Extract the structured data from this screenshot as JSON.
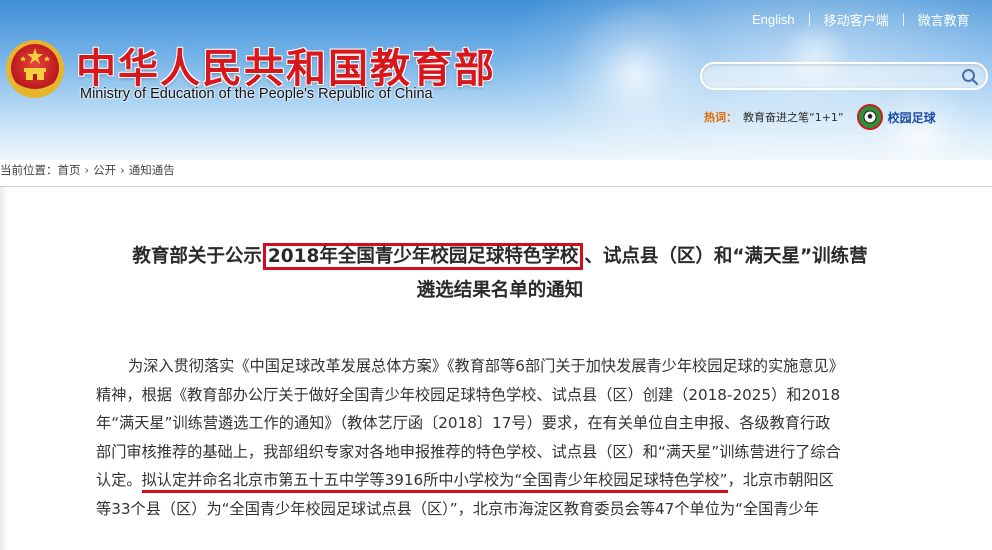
{
  "header": {
    "site_title": "中华人民共和国教育部",
    "site_subtitle": "Ministry of Education of the People's Republic of China",
    "top_links": [
      "English",
      "移动客户端",
      "微言教育"
    ],
    "search": {
      "value": "",
      "placeholder": ""
    },
    "hot": {
      "label": "热词：",
      "link": "教育奋进之笔“1+1”",
      "football_label": "校园足球"
    }
  },
  "breadcrumb": {
    "prefix": "当前位置：",
    "items": [
      "首页",
      "公开",
      "通知通告"
    ],
    "separator": "›"
  },
  "article": {
    "title_line1_before": "教育部关于公示",
    "title_line1_highlight": "2018年全国青少年校园足球特色学校",
    "title_line1_after": "、试点县（区）和“满天星”训练营",
    "title_line2": "遴选结果名单的通知",
    "body_lines": [
      "为深入贯彻落实《中国足球改革发展总体方案》《教育部等6部门关于加快发展青少年校园足球的实施意见》",
      "精神，根据《教育部办公厅关于做好全国青少年校园足球特色学校、试点县（区）创建（2018-2025）和2018",
      "年“满天星”训练营遴选工作的通知》（教体艺厅函〔2018〕17号）要求，在有关单位自主申报、各级教育行政",
      "部门审核推荐的基础上，我部组织专家对各地申报推荐的特色学校、试点县（区）和“满天星”训练营进行了综合"
    ],
    "line5_before": "认定。",
    "line5_underlined": "拟认定并命名北京市第五十五中学等3916所中小学校为“全国青少年校园足球特色学校”",
    "line5_after": "，北京市朝阳区",
    "line6": "等33个县（区）为“全国青少年校园足球试点县（区）”，北京市海淀区教育委员会等47个单位为“全国青少年"
  },
  "colors": {
    "title_red": "#d8171c",
    "highlight_red": "#d10f1b",
    "hot_orange": "#e26a00",
    "football_blue": "#1e4ea8"
  }
}
